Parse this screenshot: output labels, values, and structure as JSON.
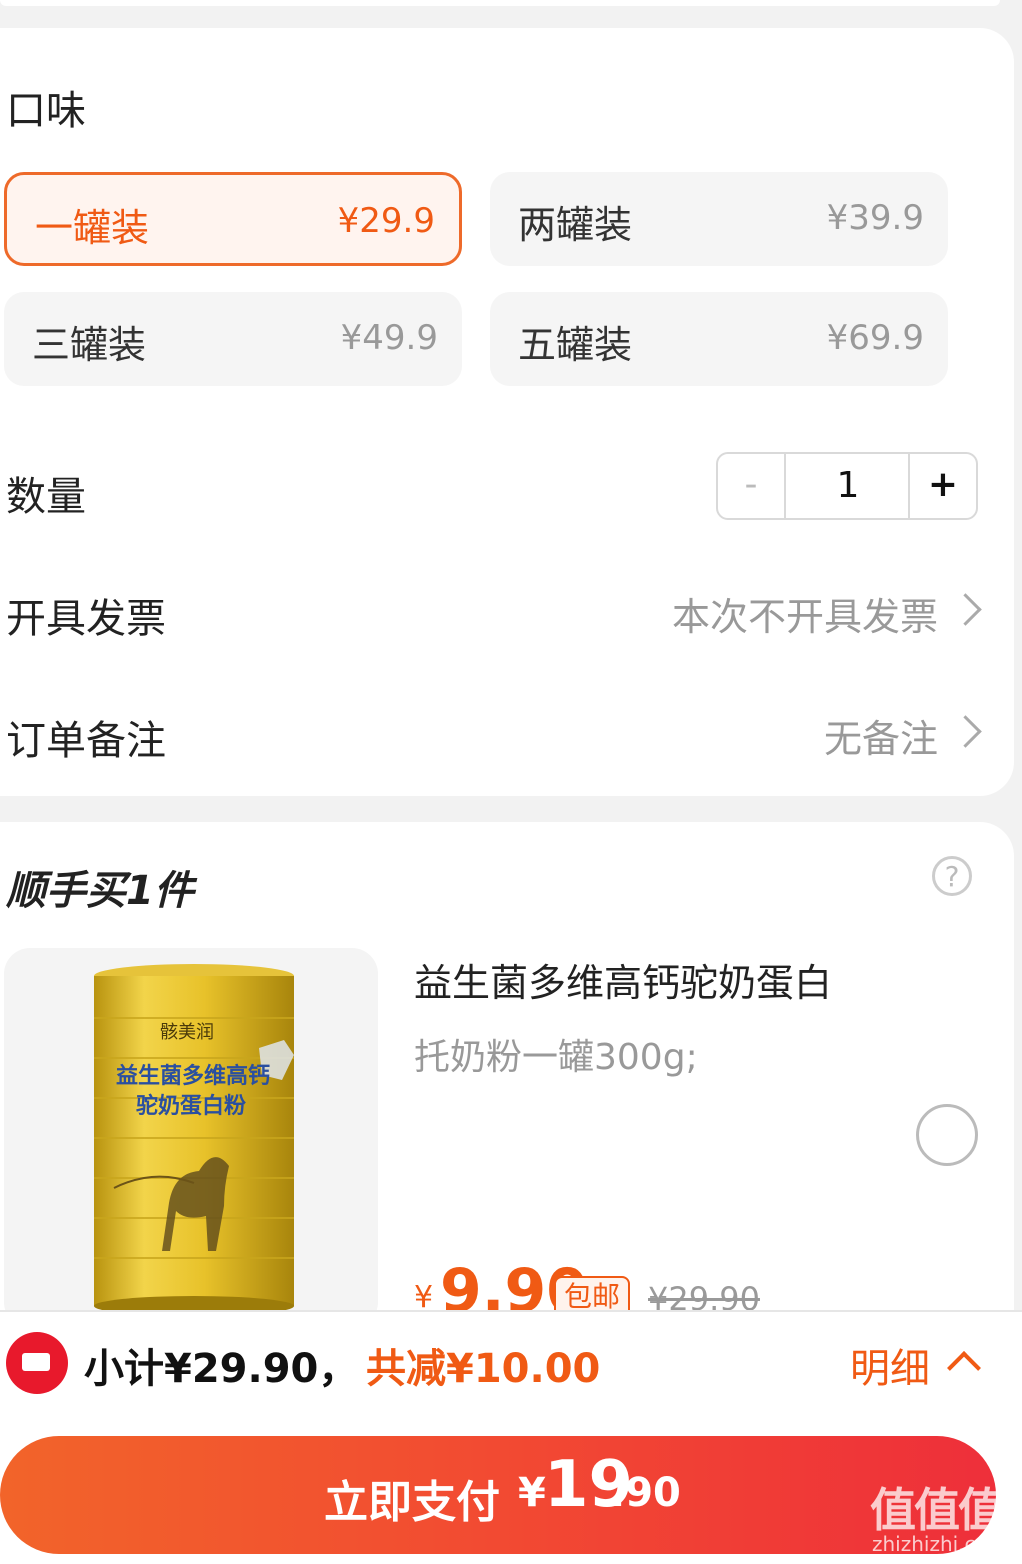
{
  "flavor": {
    "title": "口味",
    "options": [
      {
        "name": "一罐装",
        "price": "¥29.9",
        "selected": true
      },
      {
        "name": "两罐装",
        "price": "¥39.9",
        "selected": false
      },
      {
        "name": "三罐装",
        "price": "¥49.9",
        "selected": false
      },
      {
        "name": "五罐装",
        "price": "¥69.9",
        "selected": false
      }
    ]
  },
  "quantity": {
    "label": "数量",
    "minus": "-",
    "value": "1",
    "plus": "+"
  },
  "invoice": {
    "label": "开具发票",
    "value": "本次不开具发票"
  },
  "remark": {
    "label": "订单备注",
    "value": "无备注"
  },
  "upsell": {
    "title": "顺手买1件",
    "product": {
      "title": "益生菌多维高钙驼奶蛋白",
      "subtitle": "托奶粉一罐300g;",
      "price_currency": "¥",
      "price": "9.90",
      "badge": "包邮",
      "original_price": "¥29.90",
      "can_brand": "骸美润",
      "can_name_line1": "益生菌多维高钙",
      "can_name_line2": "驼奶蛋白粉"
    }
  },
  "summary": {
    "subtotal": "小计¥29.90，",
    "discount": "共减¥10.00",
    "detail": "明细"
  },
  "pay": {
    "label": "立即支付",
    "currency": "¥",
    "amount_int": "19",
    "amount_dec": ".90"
  },
  "watermark": {
    "main": "值值值",
    "sub": "zhizhizhi.com"
  },
  "colors": {
    "accent": "#f05a14",
    "pay_gradient_start": "#f2642a",
    "pay_gradient_end": "#ee2f3a"
  }
}
